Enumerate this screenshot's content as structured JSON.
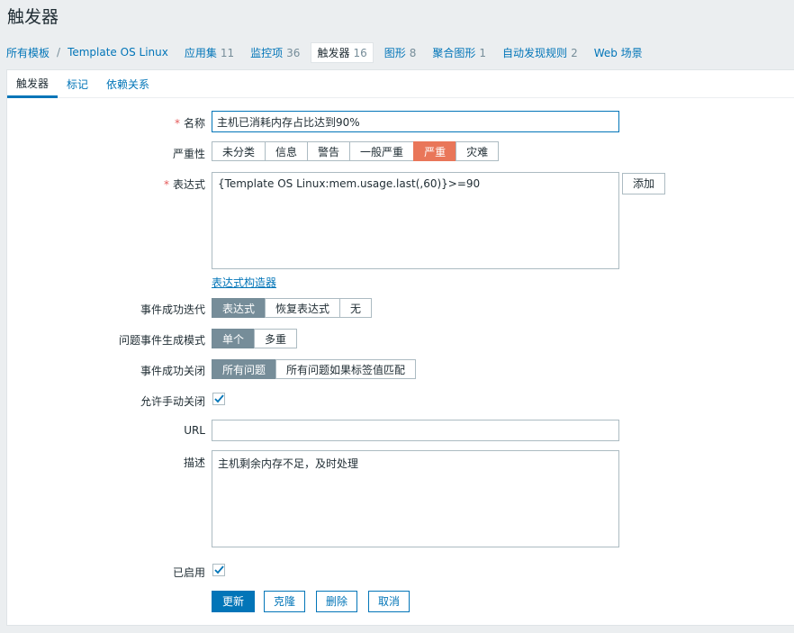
{
  "page": {
    "title": "触发器"
  },
  "breadcrumb": {
    "root": "所有模板",
    "template": "Template OS Linux",
    "items": [
      {
        "label": "应用集",
        "count": "11"
      },
      {
        "label": "监控项",
        "count": "36"
      },
      {
        "label": "触发器",
        "count": "16"
      },
      {
        "label": "图形",
        "count": "8"
      },
      {
        "label": "聚合图形",
        "count": "1"
      },
      {
        "label": "自动发现规则",
        "count": "2"
      },
      {
        "label": "Web 场景",
        "count": ""
      }
    ]
  },
  "tabs": [
    "触发器",
    "标记",
    "依赖关系"
  ],
  "form": {
    "name": {
      "label": "名称",
      "value": "主机已消耗内存占比达到90%"
    },
    "severity": {
      "label": "严重性",
      "options": [
        "未分类",
        "信息",
        "警告",
        "一般严重",
        "严重",
        "灾难"
      ],
      "selected": "严重"
    },
    "expression": {
      "label": "表达式",
      "value": "{Template OS Linux:mem.usage.last(,60)}>=90",
      "add_button": "添加",
      "builder_link": "表达式构造器"
    },
    "ok_event_generation": {
      "label": "事件成功迭代",
      "options": [
        "表达式",
        "恢复表达式",
        "无"
      ],
      "selected": "表达式"
    },
    "problem_event_mode": {
      "label": "问题事件生成模式",
      "options": [
        "单个",
        "多重"
      ],
      "selected": "单个"
    },
    "ok_event_closes": {
      "label": "事件成功关闭",
      "options": [
        "所有问题",
        "所有问题如果标签值匹配"
      ],
      "selected": "所有问题"
    },
    "manual_close": {
      "label": "允许手动关闭",
      "checked": true
    },
    "url": {
      "label": "URL",
      "value": ""
    },
    "description": {
      "label": "描述",
      "value": "主机剩余内存不足，及时处理"
    },
    "enabled": {
      "label": "已启用",
      "checked": true
    }
  },
  "actions": {
    "update": "更新",
    "clone": "克隆",
    "delete": "删除",
    "cancel": "取消"
  },
  "colors": {
    "link": "#0275b8",
    "selected_gray": "#768d99",
    "high_severity": "#e97659",
    "required": "#e45959"
  }
}
